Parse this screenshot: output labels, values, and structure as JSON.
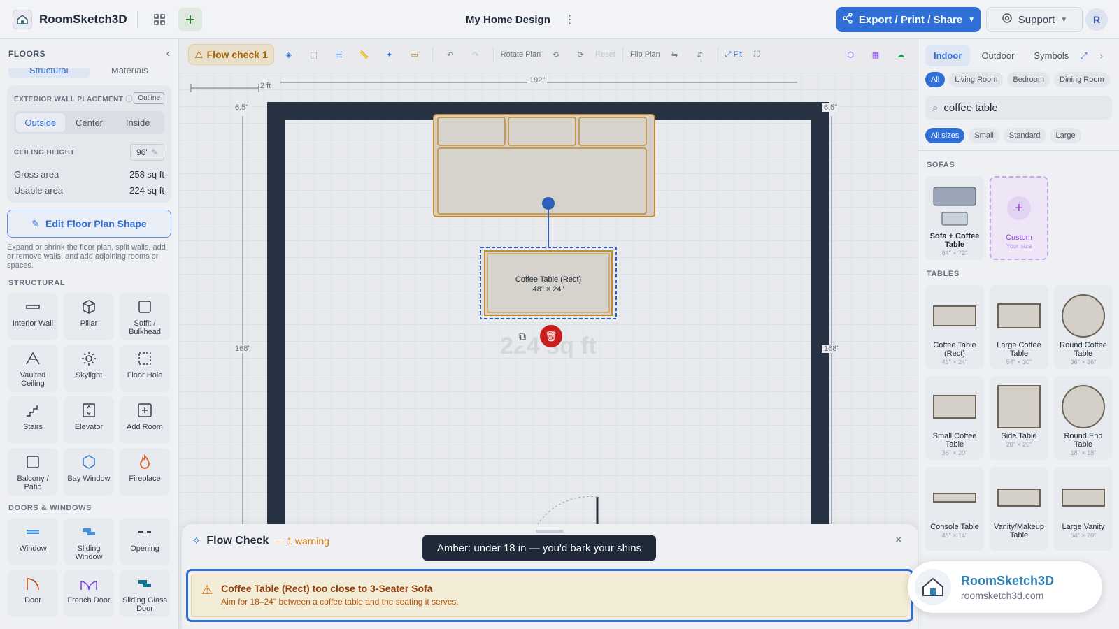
{
  "app": {
    "name": "RoomSketch3D",
    "doc_title": "My Home Design",
    "export_label": "Export / Print / Share",
    "support_label": "Support",
    "user_initial": "R"
  },
  "left": {
    "title": "FLOORS",
    "tabs": [
      "Structural",
      "Materials"
    ],
    "ewp_label": "EXTERIOR WALL PLACEMENT",
    "outline_label": "Outline",
    "placement": [
      "Outside",
      "Center",
      "Inside"
    ],
    "ceiling_label": "CEILING HEIGHT",
    "ceiling_value": "96\"",
    "gross_label": "Gross area",
    "gross_value": "258 sq ft",
    "usable_label": "Usable area",
    "usable_value": "224 sq ft",
    "edit_label": "Edit Floor Plan Shape",
    "edit_help": "Expand or shrink the floor plan, split walls, add or remove walls, and add adjoining rooms or spaces.",
    "structural_title": "STRUCTURAL",
    "structural": [
      "Interior Wall",
      "Pillar",
      "Soffit / Bulkhead",
      "Vaulted Ceiling",
      "Skylight",
      "Floor Hole",
      "Stairs",
      "Elevator",
      "Add Room",
      "Balcony / Patio",
      "Bay Window",
      "Fireplace"
    ],
    "doors_title": "DOORS & WINDOWS",
    "doors": [
      "Window",
      "Sliding Window",
      "Opening",
      "Door",
      "French Door",
      "Sliding Glass Door"
    ]
  },
  "toolbar": {
    "flow_check": "Flow check 1",
    "rotate": "Rotate Plan",
    "reset": "Reset",
    "flip": "Flip Plan",
    "fit": "Fit"
  },
  "plan": {
    "scale": "2 ft",
    "width": "192\"",
    "height": "168\"",
    "wall": "6.5\"",
    "table_label": "Coffee Table (Rect)",
    "table_size": "48\" × 24\"",
    "area_watermark": "224 sq ft"
  },
  "right": {
    "tabs": [
      "Indoor",
      "Outdoor",
      "Symbols"
    ],
    "rooms": [
      "All",
      "Living Room",
      "Bedroom",
      "Dining Room"
    ],
    "search": "coffee table",
    "sizes": [
      "All sizes",
      "Small",
      "Standard",
      "Large"
    ],
    "sofas_title": "SOFAS",
    "sofa_item": {
      "name": "Sofa + Coffee Table",
      "size": "84\" × 72\""
    },
    "custom": {
      "name": "Custom",
      "size": "Your size"
    },
    "tables_title": "TABLES",
    "tables": [
      {
        "name": "Coffee Table (Rect)",
        "size": "48\" × 24\""
      },
      {
        "name": "Large Coffee Table",
        "size": "54\" × 30\""
      },
      {
        "name": "Round Coffee Table",
        "size": "36\" × 36\""
      },
      {
        "name": "Small Coffee Table",
        "size": "36\" × 20\""
      },
      {
        "name": "Side Table",
        "size": "20\" × 20\""
      },
      {
        "name": "Round End Table",
        "size": "18\" × 18\""
      },
      {
        "name": "Console Table",
        "size": "48\" × 14\""
      },
      {
        "name": "Vanity/Makeup Table",
        "size": ""
      },
      {
        "name": "Large Vanity",
        "size": "54\" × 20\""
      }
    ]
  },
  "flow": {
    "title": "Flow Check",
    "count": "— 1 warning",
    "warning_title": "Coffee Table (Rect) too close to 3-Seater Sofa",
    "warning_sub": "Aim for 18–24\" between a coffee table and the seating it serves.",
    "tooltip": "Amber: under 18 in — you'd bark your shins"
  },
  "brand": {
    "name": "RoomSketch3D",
    "url": "roomsketch3d.com"
  }
}
